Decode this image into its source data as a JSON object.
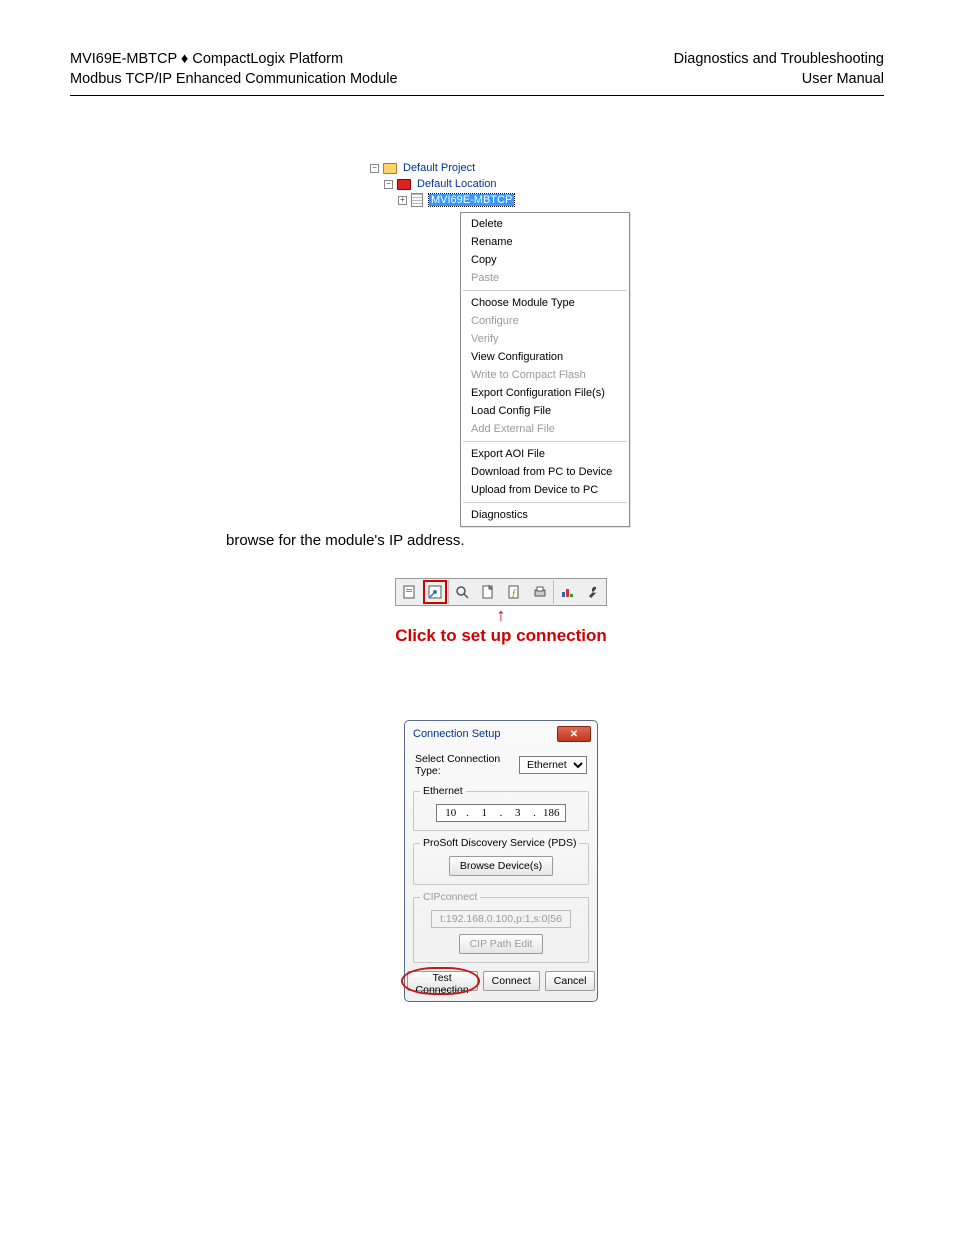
{
  "header": {
    "left_line1": "MVI69E-MBTCP ♦ CompactLogix Platform",
    "left_line2": "Modbus TCP/IP Enhanced Communication Module",
    "right_line1": "Diagnostics and Troubleshooting",
    "right_line2": "User Manual"
  },
  "tree": {
    "root": "Default Project",
    "location": "Default Location",
    "selected_module": "MVI69E-MBTCP"
  },
  "context_menu": {
    "items": [
      {
        "label": "Delete",
        "enabled": true
      },
      {
        "label": "Rename",
        "enabled": true
      },
      {
        "label": "Copy",
        "enabled": true
      },
      {
        "label": "Paste",
        "enabled": false
      },
      {
        "sep": true
      },
      {
        "label": "Choose Module Type",
        "enabled": true
      },
      {
        "label": "Configure",
        "enabled": false
      },
      {
        "label": "Verify",
        "enabled": false
      },
      {
        "label": "View Configuration",
        "enabled": true
      },
      {
        "label": "Write to Compact Flash",
        "enabled": false
      },
      {
        "label": "Export Configuration File(s)",
        "enabled": true
      },
      {
        "label": "Load Config File",
        "enabled": true
      },
      {
        "label": "Add External File",
        "enabled": false
      },
      {
        "sep": true
      },
      {
        "label": "Export AOI File",
        "enabled": true
      },
      {
        "label": "Download from PC to Device",
        "enabled": true
      },
      {
        "label": "Upload from Device to PC",
        "enabled": true
      },
      {
        "sep": true
      },
      {
        "label": "Diagnostics",
        "enabled": true
      }
    ]
  },
  "body_text": "browse for the module's IP address.",
  "toolbar_caption": "Click to set up connection",
  "dialog": {
    "title": "Connection Setup",
    "select_label": "Select Connection Type:",
    "select_value": "Ethernet",
    "group_ethernet": "Ethernet",
    "ip": {
      "a": "10",
      "b": "1",
      "c": "3",
      "d": "186"
    },
    "group_pds": "ProSoft Discovery Service (PDS)",
    "browse_btn": "Browse Device(s)",
    "group_cip": "CIPconnect",
    "cip_value": "t:192.168.0.100,p:1,s:0|56",
    "cip_btn": "CIP Path Edit",
    "test_btn": "Test Connection",
    "connect_btn": "Connect",
    "cancel_btn": "Cancel"
  }
}
